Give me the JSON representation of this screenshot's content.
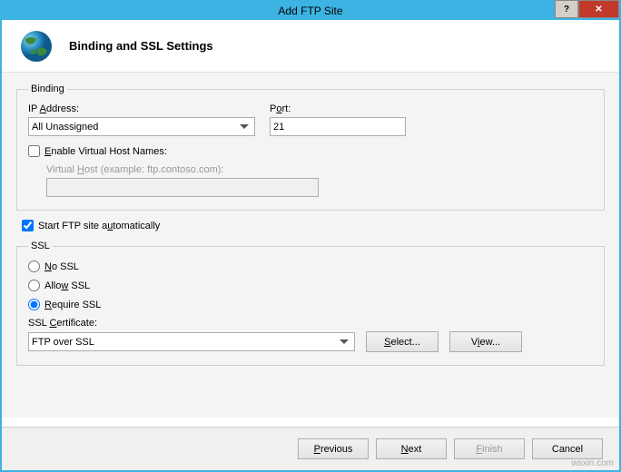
{
  "window": {
    "title": "Add FTP Site",
    "help": "?",
    "close": "✕"
  },
  "header": {
    "title": "Binding and SSL Settings"
  },
  "binding": {
    "legend": "Binding",
    "ip_label_pre": "IP",
    "ip_label_m": "A",
    "ip_label_post": "ddress:",
    "ip_value": "All Unassigned",
    "port_label_pre": "P",
    "port_label_m": "o",
    "port_label_post": "rt:",
    "port_value": "21",
    "vhost_check_pre": "",
    "vhost_check_m": "E",
    "vhost_check_post": "nable Virtual Host Names:",
    "vhost_field_pre": "Virtual",
    "vhost_field_m": "H",
    "vhost_field_post": "ost (example: ftp.contoso.com):"
  },
  "autostart": {
    "label_pre": "Start FTP site a",
    "label_m": "u",
    "label_post": "tomatically",
    "checked": true
  },
  "ssl": {
    "legend": "SSL",
    "no_ssl_pre": "",
    "no_ssl_m": "N",
    "no_ssl_post": "o SSL",
    "allow_pre": "Allo",
    "allow_m": "w",
    "allow_post": " SSL",
    "require_pre": "",
    "require_m": "R",
    "require_post": "equire SSL",
    "cert_label_pre": "SSL",
    "cert_label_m": "C",
    "cert_label_post": "ertificate:",
    "cert_value": "FTP over SSL",
    "select_btn_pre": "",
    "select_btn_m": "S",
    "select_btn_post": "elect...",
    "view_btn_pre": "V",
    "view_btn_m": "i",
    "view_btn_post": "ew..."
  },
  "footer": {
    "previous_pre": "",
    "previous_m": "P",
    "previous_post": "revious",
    "next_pre": "",
    "next_m": "N",
    "next_post": "ext",
    "finish_pre": "",
    "finish_m": "F",
    "finish_post": "inish",
    "cancel": "Cancel"
  },
  "watermark": "wsxin.com"
}
